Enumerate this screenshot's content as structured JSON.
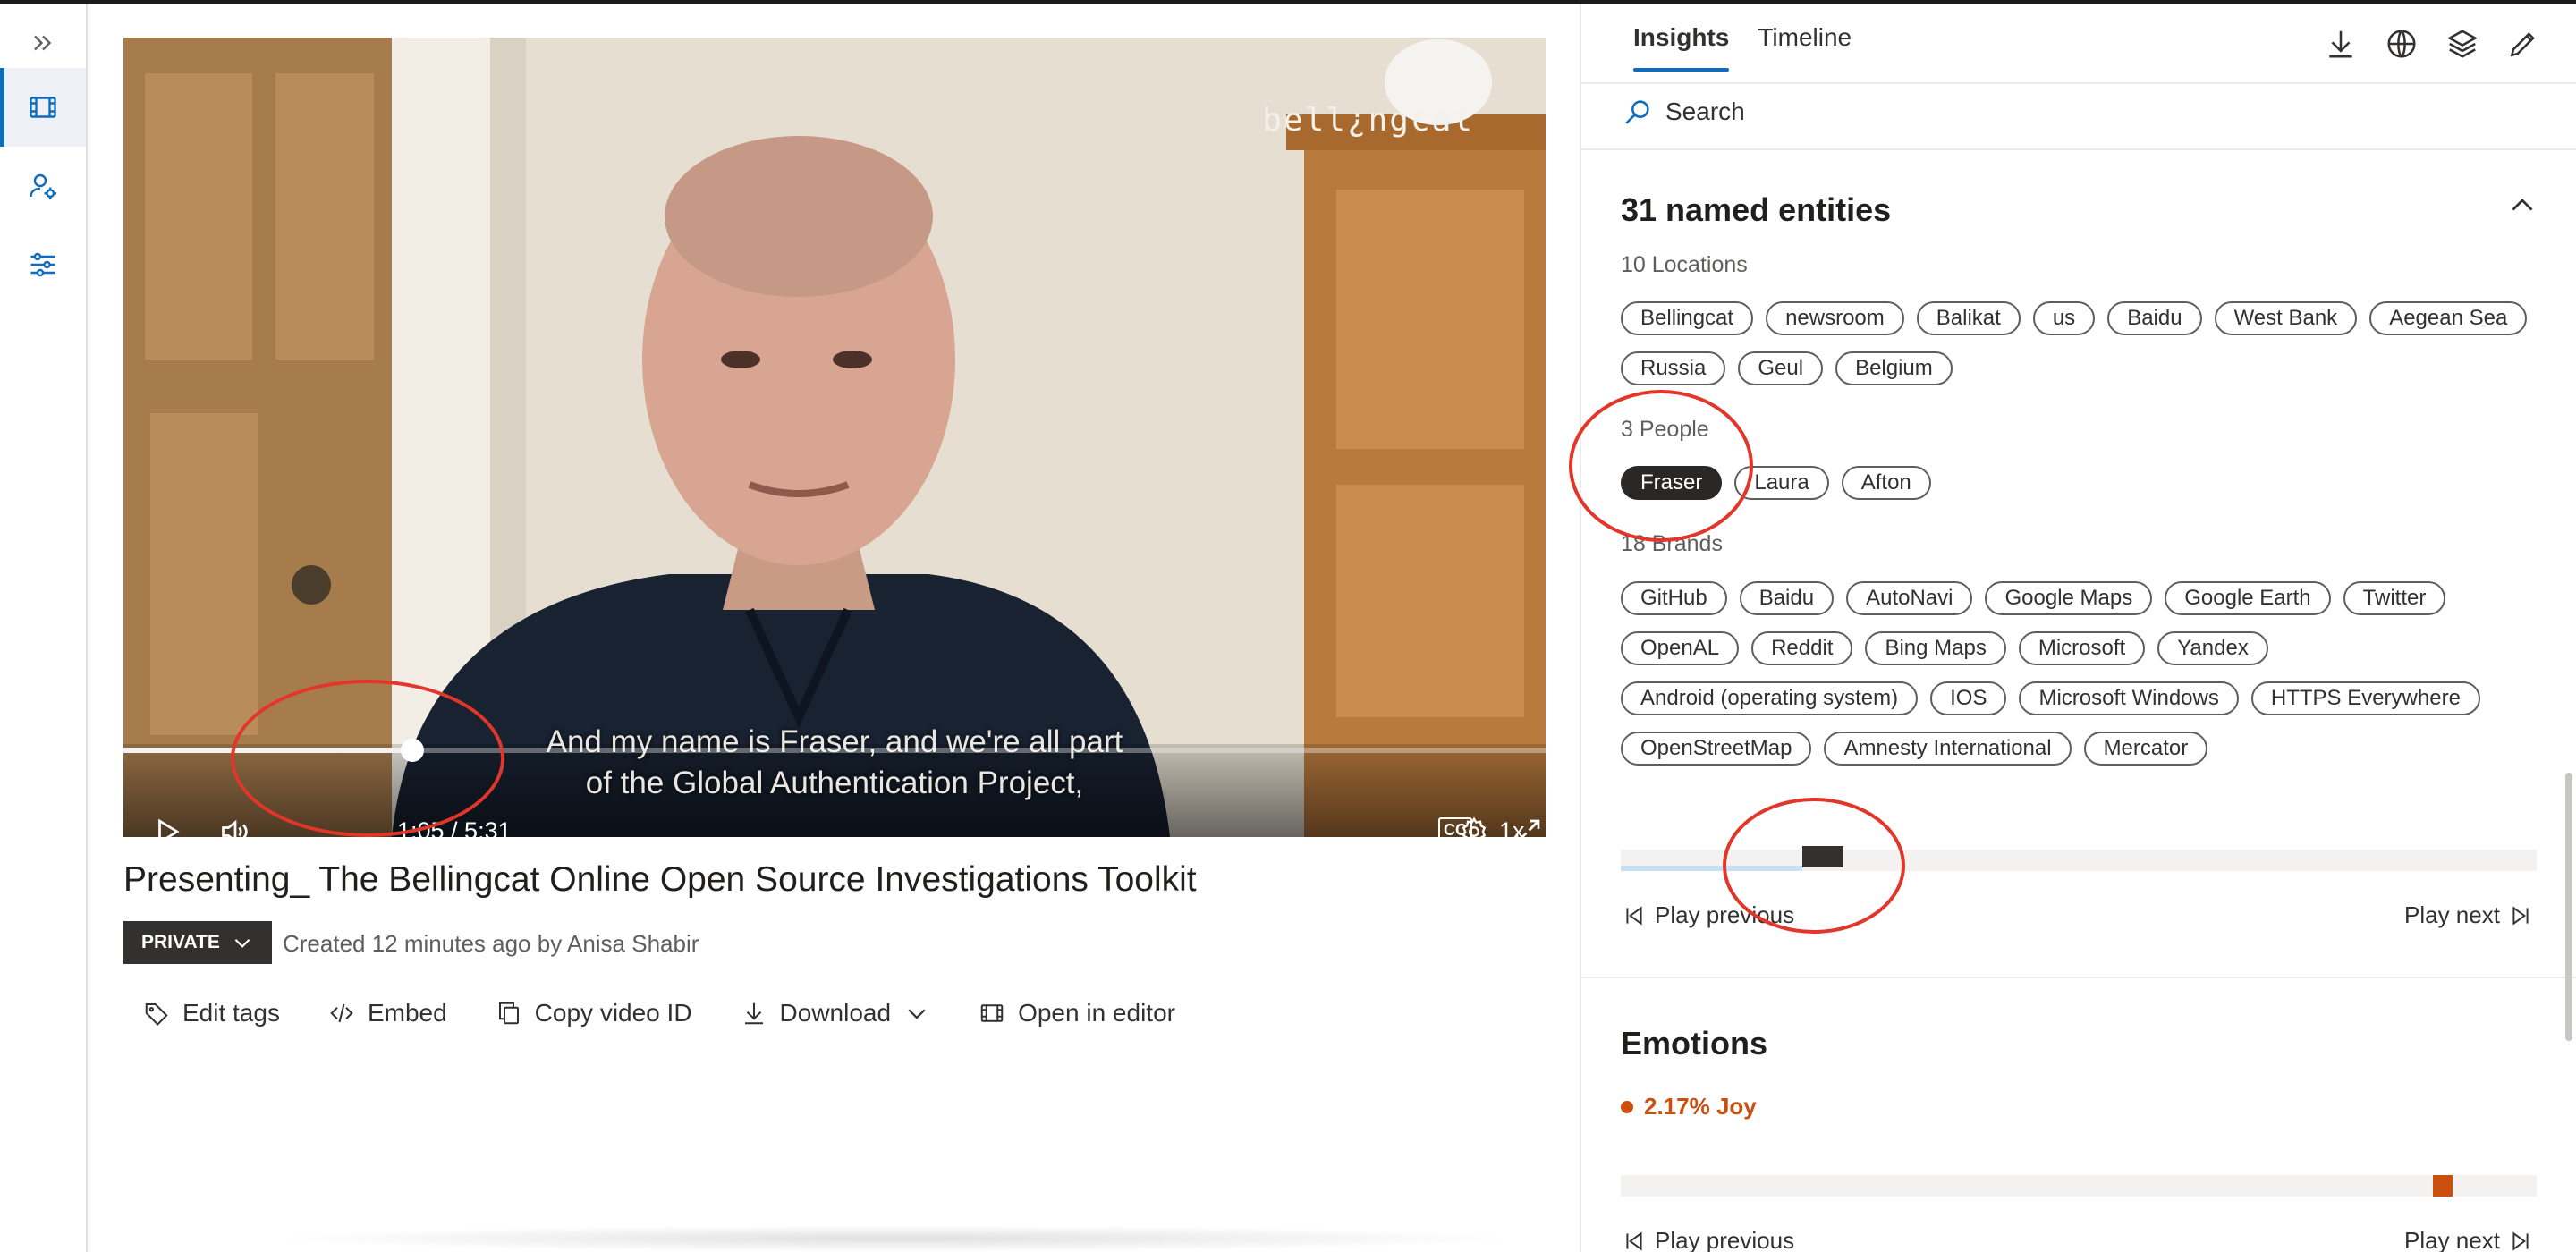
{
  "rail": {
    "expand_icon": "expand-chevrons-icon",
    "items": [
      {
        "name": "media-icon",
        "active": true
      },
      {
        "name": "user-settings-icon",
        "active": false
      },
      {
        "name": "filters-icon",
        "active": false
      }
    ]
  },
  "player": {
    "watermark": "bell¿ngcat",
    "subtitle_line1": "And my name is Fraser, and we're all part",
    "subtitle_line2": "of the Global Authentication Project,",
    "time": "1:05 / 5:31",
    "progress_fraction": 0.203,
    "cc_label": "CC",
    "speed_label": "1x",
    "icons": [
      "play-icon",
      "volume-icon",
      "closed-captions-icon",
      "settings-gear-icon",
      "fullscreen-icon"
    ]
  },
  "video": {
    "title": "Presenting_ The Bellingcat Online Open Source Investigations Toolkit",
    "privacy_label": "PRIVATE",
    "created_text": "Created 12 minutes ago by Anisa Shabir"
  },
  "actions": [
    {
      "label": "Edit tags",
      "icon": "tag-icon"
    },
    {
      "label": "Embed",
      "icon": "code-icon"
    },
    {
      "label": "Copy video ID",
      "icon": "copy-icon"
    },
    {
      "label": "Download",
      "icon": "download-icon"
    },
    {
      "label": "Open in editor",
      "icon": "film-icon"
    }
  ],
  "panel": {
    "tabs": [
      {
        "label": "Insights",
        "active": true
      },
      {
        "label": "Timeline",
        "active": false
      }
    ],
    "top_icons": [
      "download-icon",
      "globe-icon",
      "layers-icon",
      "edit-pencil-icon"
    ],
    "search_placeholder": "Search",
    "entities": {
      "title": "31 named entities",
      "locations_label": "10 Locations",
      "locations": [
        "Bellingcat",
        "newsroom",
        "Balikat",
        "us",
        "Baidu",
        "West Bank",
        "Aegean Sea",
        "Russia",
        "Geul",
        "Belgium"
      ],
      "people_label": "3 People",
      "people": [
        "Fraser",
        "Laura",
        "Afton"
      ],
      "selected_person": "Fraser",
      "brands_label": "18 Brands",
      "brands": [
        "GitHub",
        "Baidu",
        "AutoNavi",
        "Google Maps",
        "Google Earth",
        "Twitter",
        "OpenAL",
        "Reddit",
        "Bing Maps",
        "Microsoft",
        "Yandex",
        "Android (operating system)",
        "IOS",
        "Microsoft Windows",
        "HTTPS Everywhere",
        "OpenStreetMap",
        "Amnesty International",
        "Mercator"
      ],
      "appearance_fraction": 0.198,
      "played_fraction": 0.198
    },
    "play_previous": "Play previous",
    "play_next": "Play next",
    "emotions": {
      "title": "Emotions",
      "label": "2.17% Joy",
      "color": "#ca5010",
      "marker_fraction": 0.887
    }
  },
  "colors": {
    "accent": "#0f6cbd",
    "annotation": "#e2362b",
    "chip_selected": "#292827"
  }
}
